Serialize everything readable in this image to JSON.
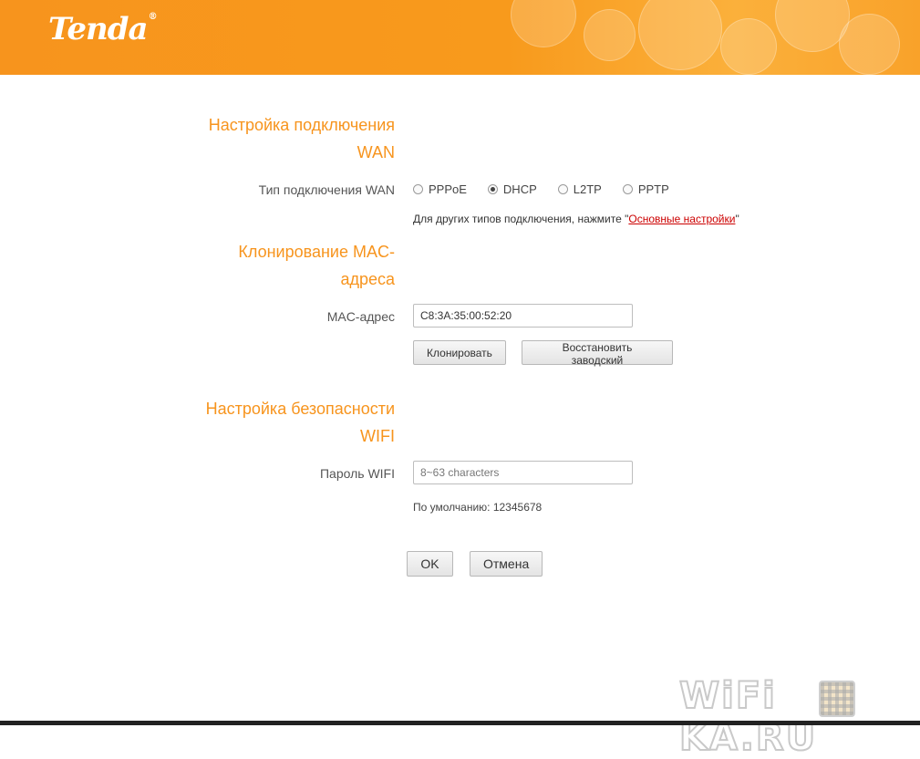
{
  "brand": {
    "logo_text": "Tenda",
    "logo_mark": "®"
  },
  "wan": {
    "title": "Настройка подключения WAN",
    "title_line1": "Настройка подключения",
    "title_line2": "WAN",
    "type_label": "Тип подключения WAN",
    "options": [
      {
        "label": "PPPoE",
        "selected": false
      },
      {
        "label": "DHCP",
        "selected": true
      },
      {
        "label": "L2TP",
        "selected": false
      },
      {
        "label": "PPTP",
        "selected": false
      }
    ],
    "hint_prefix": "Для других типов подключения, нажмите \"",
    "hint_link": "Основные настройки",
    "hint_suffix": "\""
  },
  "mac": {
    "title_line1": "Клонирование MAC-",
    "title_line2": "адреса",
    "label": "MAC-адрес",
    "value": "C8:3A:35:00:52:20",
    "clone_button": "Клонировать",
    "restore_button": "Восстановить заводский"
  },
  "wifi": {
    "title_line1": "Настройка безопасности",
    "title_line2": "WIFI",
    "password_label": "Пароль WIFI",
    "password_placeholder": "8~63 characters",
    "default_text": "По умолчанию: 12345678"
  },
  "actions": {
    "ok": "OK",
    "cancel": "Отмена"
  },
  "watermark": {
    "text_left": "WiFi",
    "text_right": "KA",
    "text_end": ".RU"
  },
  "colors": {
    "accent": "#f7941d",
    "link": "#cc0000"
  }
}
